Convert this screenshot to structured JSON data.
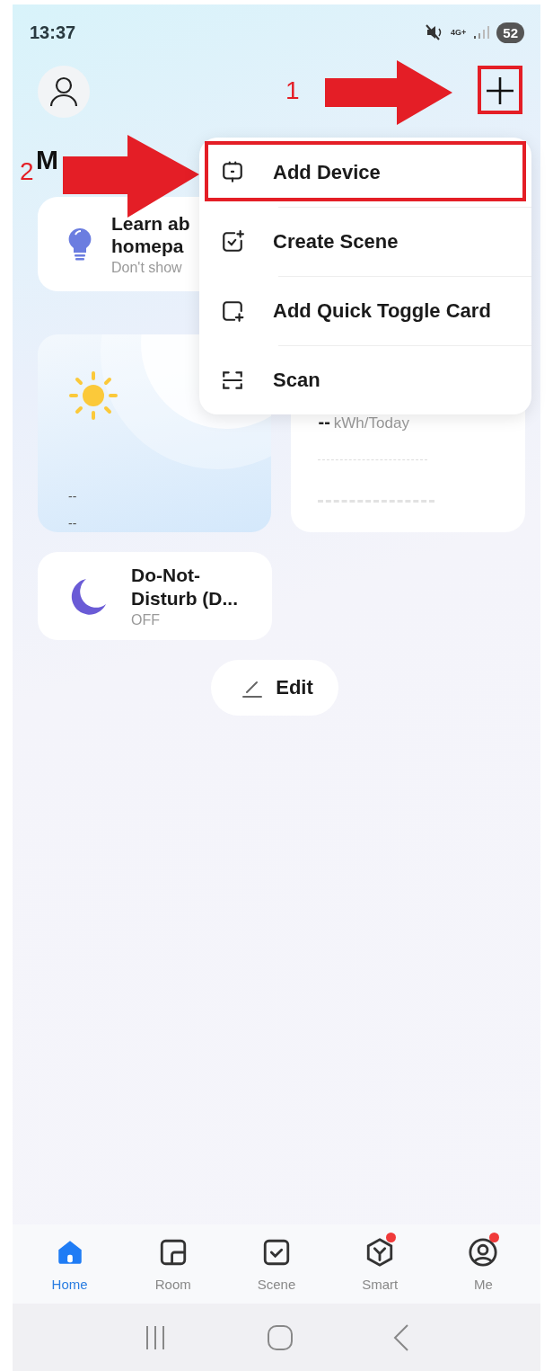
{
  "status_bar": {
    "time": "13:37",
    "network": "4G+",
    "battery": "52"
  },
  "heading": "M",
  "annotations": [
    {
      "label": "1"
    },
    {
      "label": "2"
    }
  ],
  "tip_card": {
    "title_lines": [
      "Learn ab",
      "homepa"
    ],
    "subtitle": "Don't show"
  },
  "weather_card": {
    "lines": [
      "--",
      "--"
    ]
  },
  "energy_card": {
    "value": "--",
    "unit": "kWh/Today"
  },
  "dnd_card": {
    "title": "Do-Not-Disturb (D...",
    "status": "OFF"
  },
  "edit_button": {
    "label": "Edit"
  },
  "menu": [
    {
      "label": "Add Device",
      "kind": "device",
      "highlighted": true
    },
    {
      "label": "Create Scene",
      "kind": "scene",
      "highlighted": false
    },
    {
      "label": "Add Quick Toggle Card",
      "kind": "card",
      "highlighted": false
    },
    {
      "label": "Scan",
      "kind": "scan",
      "highlighted": false
    }
  ],
  "tabs": [
    {
      "label": "Home",
      "kind": "home",
      "selected": true,
      "badge": false
    },
    {
      "label": "Room",
      "kind": "room",
      "selected": false,
      "badge": false
    },
    {
      "label": "Scene",
      "kind": "scene",
      "selected": false,
      "badge": false
    },
    {
      "label": "Smart",
      "kind": "smart",
      "selected": false,
      "badge": true
    },
    {
      "label": "Me",
      "kind": "me",
      "selected": false,
      "badge": true
    }
  ]
}
